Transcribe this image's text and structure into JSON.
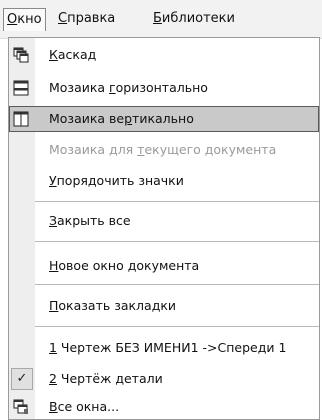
{
  "menubar": {
    "items": [
      {
        "label": "Окно",
        "ul": "О",
        "rest": "кно"
      },
      {
        "label": "Справка",
        "ul": "С",
        "rest": "правка"
      },
      {
        "label": "Библиотеки",
        "ul": "Б",
        "rest": "иблиотеки"
      }
    ]
  },
  "menu": {
    "items": [
      {
        "pre": "",
        "ul": "К",
        "post": "аскад",
        "icon": "cascade-icon"
      },
      {
        "pre": "Мозаика ",
        "ul": "г",
        "post": "оризонтально",
        "icon": "tile-horizontal-icon"
      },
      {
        "pre": "Мозаика ве",
        "ul": "р",
        "post": "тикально",
        "icon": "tile-vertical-icon",
        "highlighted": true
      },
      {
        "pre": "Мозаика для ",
        "ul": "т",
        "post": "екущего документа",
        "disabled": true
      },
      {
        "pre": "",
        "ul": "У",
        "post": "порядочить значки"
      },
      {
        "pre": "",
        "ul": "З",
        "post": "акрыть все"
      },
      {
        "pre": "",
        "ul": "Н",
        "post": "овое окно документа"
      },
      {
        "pre": "",
        "ul": "П",
        "post": "оказать закладки"
      },
      {
        "pre": "",
        "ul": "1",
        "post": " Чертеж БЕЗ ИМЕНИ1 ->Спереди 1"
      },
      {
        "pre": "",
        "ul": "2",
        "post": " Чертёж детали",
        "checked": true
      },
      {
        "pre": "",
        "ul": "В",
        "post": "се окна...",
        "icon": "all-windows-icon"
      }
    ],
    "check_glyph": "✓"
  }
}
